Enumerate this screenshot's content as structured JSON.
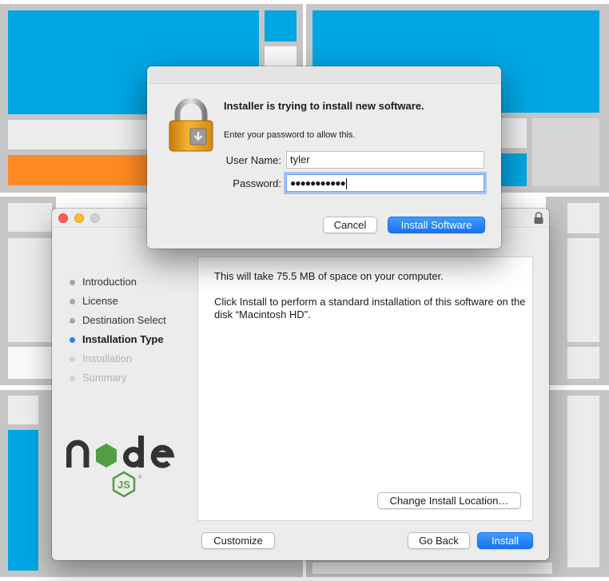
{
  "installer": {
    "steps": [
      {
        "label": "Introduction",
        "state": "done"
      },
      {
        "label": "License",
        "state": "done"
      },
      {
        "label": "Destination Select",
        "state": "done"
      },
      {
        "label": "Installation Type",
        "state": "active"
      },
      {
        "label": "Installation",
        "state": "pending"
      },
      {
        "label": "Summary",
        "state": "pending"
      }
    ],
    "content": {
      "size_text": "This will take 75.5 MB of space on your computer.",
      "install_text": "Click Install to perform a standard installation of this software on the disk “Macintosh HD”."
    },
    "buttons": {
      "change_location": "Change Install Location…",
      "customize": "Customize",
      "go_back": "Go Back",
      "install": "Install"
    },
    "logo_text": "node js"
  },
  "auth_dialog": {
    "title": "Installer is trying to install new software.",
    "subtitle": "Enter your password to allow this.",
    "username_label": "User Name:",
    "username_value": "tyler",
    "password_label": "Password:",
    "password_mask": "●●●●●●●●●●●",
    "cancel_label": "Cancel",
    "install_label": "Install Software"
  },
  "colors": {
    "wallpaper_blue": "#00a6e3",
    "wallpaper_orange": "#ff8a24",
    "wallpaper_grey": "#c6c6c6",
    "accent_blue": "#1a73f0",
    "node_green": "#539e43",
    "node_dark": "#333333"
  }
}
